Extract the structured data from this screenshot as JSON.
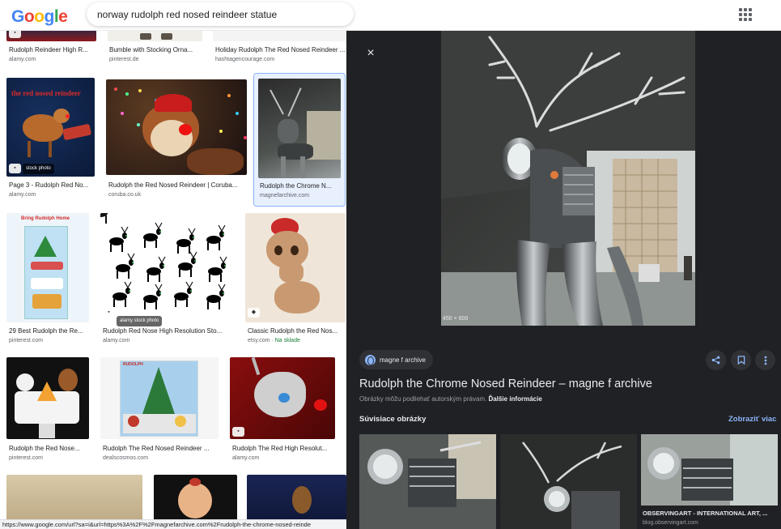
{
  "header": {
    "logo_letters": [
      "G",
      "o",
      "o",
      "g",
      "l",
      "e"
    ],
    "logo_colors": [
      "#4285f4",
      "#ea4335",
      "#fbbc05",
      "#4285f4",
      "#34a853",
      "#ea4335"
    ],
    "search_value": "norway rudolph red nosed reindeer statue"
  },
  "results": [
    {
      "title": "Rudolph Reindeer High R...",
      "source": "alamy.com"
    },
    {
      "title": "Bumble with Stocking Orna...",
      "source": "pinterest.de"
    },
    {
      "title": "Holiday Rudolph The Red Nosed Reindeer ...",
      "source": "hashtagencourage.com"
    },
    {
      "title": "Page 3 - Rudolph Red No...",
      "source": "alamy.com",
      "tag": "stock photo"
    },
    {
      "title": "Rudolph the Red Nosed Reindeer | Coruba...",
      "source": "coruba.co.uk"
    },
    {
      "title": "Rudolph the Chrome N...",
      "source": "magnefarchive.com"
    },
    {
      "title": "29 Best Rudolph the Re...",
      "source": "pinterest.com",
      "image_text": "Bring Rudolph Home"
    },
    {
      "title": "Rudolph Red Nose High Resolution Sto...",
      "source": "alamy.com",
      "tag": "alamy stock photo"
    },
    {
      "title": "Classic Rudolph the Red Nos...",
      "source": "etsy.com",
      "extra": "Na sklade"
    },
    {
      "title": "Rudolph the Red Nose...",
      "source": "pinterest.com"
    },
    {
      "title": "Rudolph The Red Nosed Reindeer ...",
      "source": "dealscosmos.com",
      "image_text": "RUDOLPH"
    },
    {
      "title": "Rudolph The Red High Resolut...",
      "source": "alamy.com"
    }
  ],
  "status_url": "https://www.google.com/url?sa=i&url=https%3A%2F%2Fmagnefarchive.com%2Frudolph-the-chrome-nosed-reinde",
  "panel": {
    "close_label": "×",
    "dimensions": "450 × 600",
    "source_name": "magne f archive",
    "title": "Rudolph the Chrome Nosed Reindeer – magne f archive",
    "notice": "Obrázky môžu podliehať autorským právam.",
    "notice_link": "Ďalšie informácie",
    "related_heading": "Súvisiace obrázky",
    "view_more": "Zobraziť viac",
    "related": [
      {
        "caption": "",
        "source": ""
      },
      {
        "caption": "",
        "source": ""
      },
      {
        "caption": "OBSERVINGART - INTERNATIONAL ART, ...",
        "source": "blog.observingart.com"
      }
    ]
  },
  "icons": {
    "apps": "apps-grid-icon",
    "close": "close-icon",
    "share": "share-icon",
    "save": "bookmark-icon",
    "more": "more-vert-icon",
    "globe": "globe-icon"
  }
}
